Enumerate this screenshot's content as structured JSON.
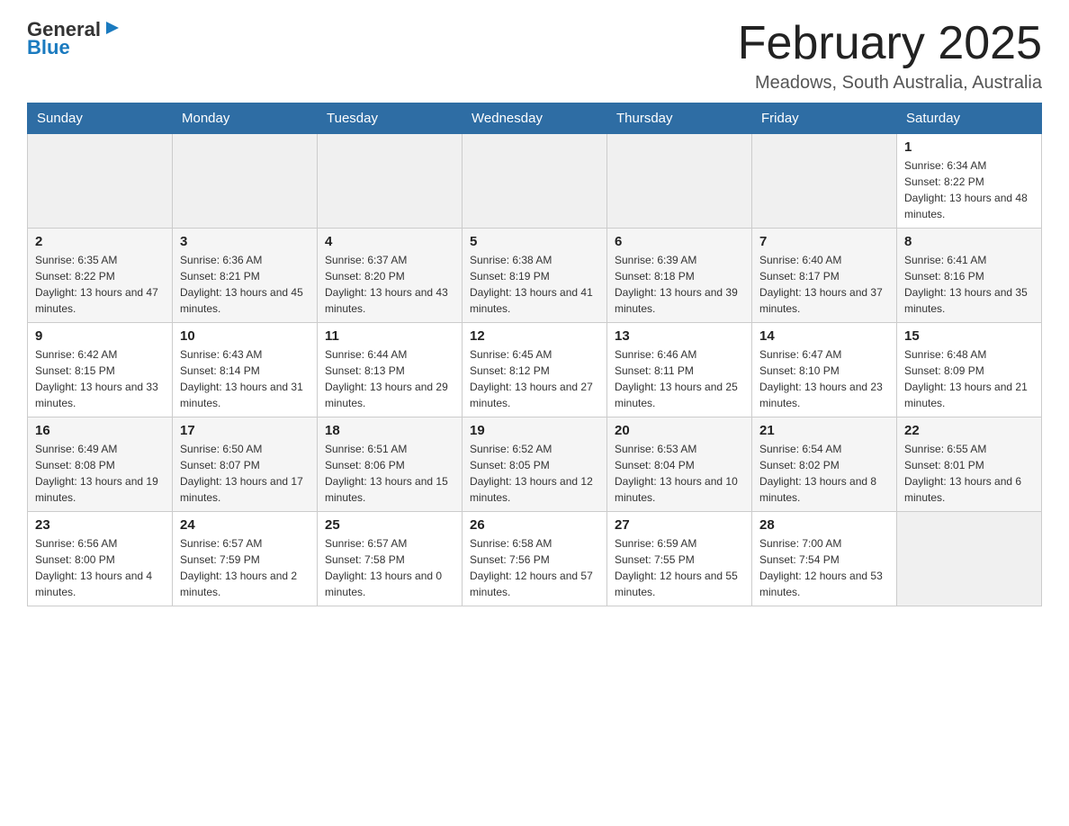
{
  "header": {
    "logo_general": "General",
    "logo_blue": "Blue",
    "month_title": "February 2025",
    "location": "Meadows, South Australia, Australia"
  },
  "days_of_week": [
    "Sunday",
    "Monday",
    "Tuesday",
    "Wednesday",
    "Thursday",
    "Friday",
    "Saturday"
  ],
  "weeks": [
    {
      "days": [
        {
          "number": "",
          "info": ""
        },
        {
          "number": "",
          "info": ""
        },
        {
          "number": "",
          "info": ""
        },
        {
          "number": "",
          "info": ""
        },
        {
          "number": "",
          "info": ""
        },
        {
          "number": "",
          "info": ""
        },
        {
          "number": "1",
          "info": "Sunrise: 6:34 AM\nSunset: 8:22 PM\nDaylight: 13 hours and 48 minutes."
        }
      ]
    },
    {
      "days": [
        {
          "number": "2",
          "info": "Sunrise: 6:35 AM\nSunset: 8:22 PM\nDaylight: 13 hours and 47 minutes."
        },
        {
          "number": "3",
          "info": "Sunrise: 6:36 AM\nSunset: 8:21 PM\nDaylight: 13 hours and 45 minutes."
        },
        {
          "number": "4",
          "info": "Sunrise: 6:37 AM\nSunset: 8:20 PM\nDaylight: 13 hours and 43 minutes."
        },
        {
          "number": "5",
          "info": "Sunrise: 6:38 AM\nSunset: 8:19 PM\nDaylight: 13 hours and 41 minutes."
        },
        {
          "number": "6",
          "info": "Sunrise: 6:39 AM\nSunset: 8:18 PM\nDaylight: 13 hours and 39 minutes."
        },
        {
          "number": "7",
          "info": "Sunrise: 6:40 AM\nSunset: 8:17 PM\nDaylight: 13 hours and 37 minutes."
        },
        {
          "number": "8",
          "info": "Sunrise: 6:41 AM\nSunset: 8:16 PM\nDaylight: 13 hours and 35 minutes."
        }
      ]
    },
    {
      "days": [
        {
          "number": "9",
          "info": "Sunrise: 6:42 AM\nSunset: 8:15 PM\nDaylight: 13 hours and 33 minutes."
        },
        {
          "number": "10",
          "info": "Sunrise: 6:43 AM\nSunset: 8:14 PM\nDaylight: 13 hours and 31 minutes."
        },
        {
          "number": "11",
          "info": "Sunrise: 6:44 AM\nSunset: 8:13 PM\nDaylight: 13 hours and 29 minutes."
        },
        {
          "number": "12",
          "info": "Sunrise: 6:45 AM\nSunset: 8:12 PM\nDaylight: 13 hours and 27 minutes."
        },
        {
          "number": "13",
          "info": "Sunrise: 6:46 AM\nSunset: 8:11 PM\nDaylight: 13 hours and 25 minutes."
        },
        {
          "number": "14",
          "info": "Sunrise: 6:47 AM\nSunset: 8:10 PM\nDaylight: 13 hours and 23 minutes."
        },
        {
          "number": "15",
          "info": "Sunrise: 6:48 AM\nSunset: 8:09 PM\nDaylight: 13 hours and 21 minutes."
        }
      ]
    },
    {
      "days": [
        {
          "number": "16",
          "info": "Sunrise: 6:49 AM\nSunset: 8:08 PM\nDaylight: 13 hours and 19 minutes."
        },
        {
          "number": "17",
          "info": "Sunrise: 6:50 AM\nSunset: 8:07 PM\nDaylight: 13 hours and 17 minutes."
        },
        {
          "number": "18",
          "info": "Sunrise: 6:51 AM\nSunset: 8:06 PM\nDaylight: 13 hours and 15 minutes."
        },
        {
          "number": "19",
          "info": "Sunrise: 6:52 AM\nSunset: 8:05 PM\nDaylight: 13 hours and 12 minutes."
        },
        {
          "number": "20",
          "info": "Sunrise: 6:53 AM\nSunset: 8:04 PM\nDaylight: 13 hours and 10 minutes."
        },
        {
          "number": "21",
          "info": "Sunrise: 6:54 AM\nSunset: 8:02 PM\nDaylight: 13 hours and 8 minutes."
        },
        {
          "number": "22",
          "info": "Sunrise: 6:55 AM\nSunset: 8:01 PM\nDaylight: 13 hours and 6 minutes."
        }
      ]
    },
    {
      "days": [
        {
          "number": "23",
          "info": "Sunrise: 6:56 AM\nSunset: 8:00 PM\nDaylight: 13 hours and 4 minutes."
        },
        {
          "number": "24",
          "info": "Sunrise: 6:57 AM\nSunset: 7:59 PM\nDaylight: 13 hours and 2 minutes."
        },
        {
          "number": "25",
          "info": "Sunrise: 6:57 AM\nSunset: 7:58 PM\nDaylight: 13 hours and 0 minutes."
        },
        {
          "number": "26",
          "info": "Sunrise: 6:58 AM\nSunset: 7:56 PM\nDaylight: 12 hours and 57 minutes."
        },
        {
          "number": "27",
          "info": "Sunrise: 6:59 AM\nSunset: 7:55 PM\nDaylight: 12 hours and 55 minutes."
        },
        {
          "number": "28",
          "info": "Sunrise: 7:00 AM\nSunset: 7:54 PM\nDaylight: 12 hours and 53 minutes."
        },
        {
          "number": "",
          "info": ""
        }
      ]
    }
  ]
}
